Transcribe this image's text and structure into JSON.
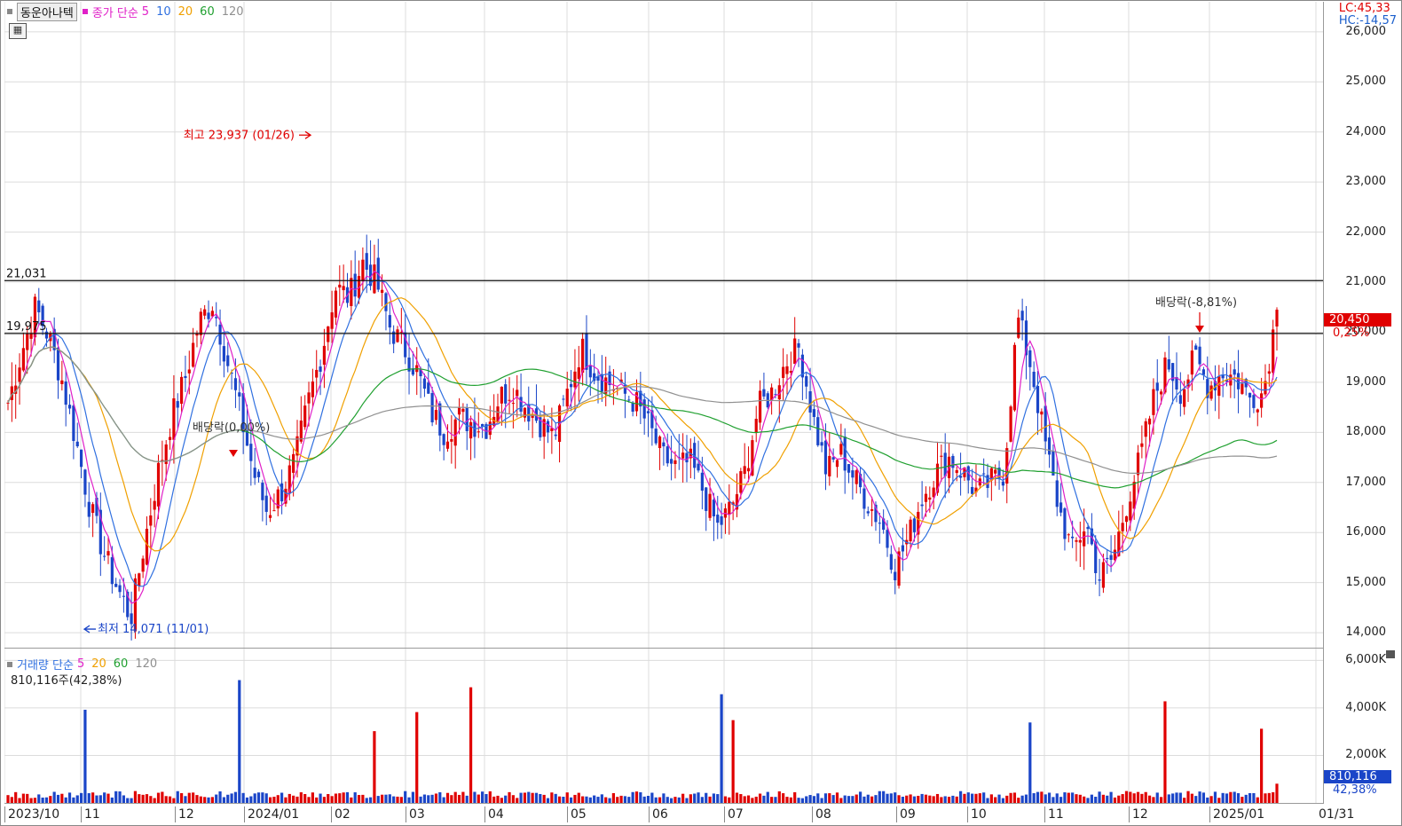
{
  "legend": {
    "stock_name": "동운아나텍",
    "price_type": "종가 단순",
    "ma_labels": [
      "5",
      "10",
      "20",
      "60",
      "120"
    ]
  },
  "volume_legend": {
    "label": "거래량 단순",
    "ma_labels": [
      "5",
      "20",
      "60",
      "120"
    ],
    "summary": "810,116주(42,38%)"
  },
  "lc_hc": {
    "lc": "LC:45,33",
    "hc": "HC:-14,57"
  },
  "colors": {
    "up": "#e00000",
    "down": "#1a45c8",
    "ma5": "#e020c8",
    "ma10": "#3070e0",
    "ma20": "#f0a000",
    "ma60": "#20a030",
    "ma120": "#909090"
  },
  "price_axis": [
    "26,000",
    "25,000",
    "24,000",
    "23,000",
    "22,000",
    "21,000",
    "20,000",
    "19,000",
    "18,000",
    "17,000",
    "16,000",
    "15,000",
    "14,000"
  ],
  "volume_axis": [
    "6,000K",
    "4,000K",
    "2,000K"
  ],
  "x_axis": [
    "2023/10",
    "11",
    "12",
    "2024/01",
    "02",
    "03",
    "04",
    "05",
    "06",
    "07",
    "08",
    "09",
    "10",
    "11",
    "12",
    "2025/01",
    "01/31"
  ],
  "current_price": "20,450",
  "current_pct": "0,25%",
  "current_volume": "810,116",
  "current_volume_pct": "42,38%",
  "annotations": {
    "high": "최고 23,937 (01/26)",
    "low": "최저 14,071 (11/01)",
    "div1": "배당락(0,00%)",
    "div2": "배당락(-8,81%)",
    "level1": "21,031",
    "level2": "19,975"
  },
  "chart_data": {
    "type": "candlestick",
    "title": "동운아나텍",
    "x_range": [
      "2023/10",
      "2025/01/31"
    ],
    "ylim": [
      13700,
      26600
    ],
    "horizontal_lines": [
      21031,
      19975
    ],
    "extremes": {
      "high": 23937,
      "high_date": "01/26",
      "low": 14071,
      "low_date": "11/01"
    },
    "last_close": 20450,
    "change_pct": 0.25,
    "series": [
      {
        "name": "종가",
        "values": [
          18600,
          19600,
          20500,
          19900,
          19000,
          17800,
          16500,
          15600,
          14900,
          14300,
          15800,
          17200,
          18300,
          19100,
          20200,
          20600,
          19500,
          18400,
          17200,
          16400,
          16800,
          17400,
          18600,
          19600,
          20900,
          20700,
          21400,
          21000,
          20100,
          19700,
          19200,
          18400,
          18000,
          18300,
          18200,
          18100,
          18700,
          18900,
          18500,
          18200,
          17900,
          18800,
          19700,
          19200,
          19000,
          18800,
          18600,
          18100,
          17500,
          17300,
          17400,
          16800,
          16100,
          16500,
          17200,
          18500,
          18800,
          19400,
          19700,
          18300,
          17200,
          17600,
          17100,
          16600,
          16200,
          15300,
          15900,
          16700,
          17200,
          17500,
          17200,
          16800,
          17000,
          17200,
          20300,
          19300,
          17800,
          16500,
          15600,
          16200,
          15100,
          15500,
          16600,
          17500,
          18700,
          19400,
          18800,
          19500,
          18900,
          19200,
          19100,
          18700,
          18800,
          20450
        ]
      },
      {
        "name": "5",
        "values": []
      },
      {
        "name": "10",
        "values": []
      },
      {
        "name": "20",
        "values": []
      },
      {
        "name": "60",
        "values": []
      },
      {
        "name": "120",
        "values": []
      }
    ],
    "volume_ylim": [
      0,
      6500000
    ],
    "volume_last": 810116
  }
}
